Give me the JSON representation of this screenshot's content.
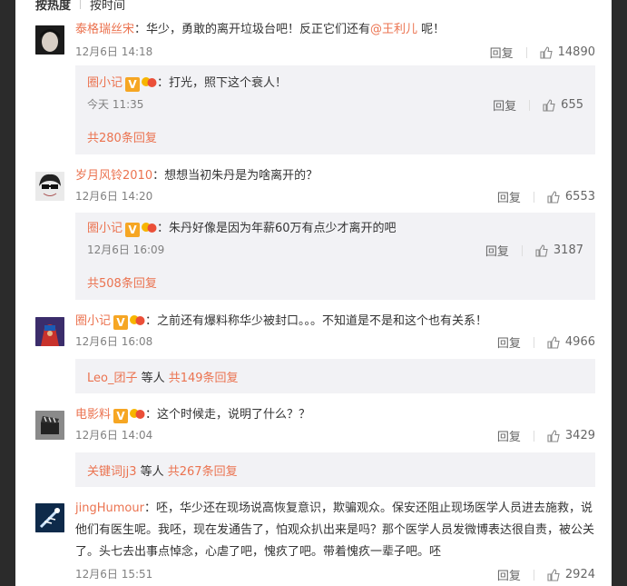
{
  "tabs": {
    "hot": "按热度",
    "time": "按时间"
  },
  "comments": [
    {
      "user": "泰格瑞丝宋",
      "text_before": "：华少，勇敢的离开垃圾台吧！反正它们还有",
      "mention": "@王利儿",
      "text_after": " 呢！",
      "time": "12月6日 14:18",
      "reply": "回复",
      "likes": "14890",
      "sub": {
        "user": "圈小记",
        "text": "：打光，照下这个衰人！",
        "time": "今天 11:35",
        "reply": "回复",
        "likes": "655",
        "more": "共280条回复"
      }
    },
    {
      "user": "岁月风铃2010",
      "text": "：想想当初朱丹是为啥离开的？",
      "time": "12月6日 14:20",
      "reply": "回复",
      "likes": "6553",
      "sub": {
        "user": "圈小记",
        "text": "：朱丹好像是因为年薪60万有点少才离开的吧",
        "time": "12月6日 16:09",
        "reply": "回复",
        "likes": "3187",
        "more": "共508条回复"
      }
    },
    {
      "user": "圈小记",
      "text": "：之前还有爆料称华少被封口。。。不知道是不是和这个也有关系！",
      "time": "12月6日 16:08",
      "reply": "回复",
      "likes": "4966",
      "more_user": "Leo_团子",
      "more_mid": " 等人 ",
      "more": "共149条回复"
    },
    {
      "user": "电影料",
      "text": "：这个时候走，说明了什么？？",
      "time": "12月6日 14:04",
      "reply": "回复",
      "likes": "3429",
      "more_user": "关键词jj3",
      "more_mid": " 等人 ",
      "more": "共267条回复"
    },
    {
      "user": "jingHumour",
      "text": "：呸，华少还在现场说高恢复意识，欺骗观众。保安还阻止现场医学人员进去施救，说他们有医生呢。我呸，现在发通告了，怕观众扒出来是吗？那个医学人员发微博表达很自责，被公关了。头七去出事点悼念，心虐了吧，愧疚了吧。带着愧疚一辈子吧。呸",
      "time": "12月6日 15:51",
      "reply": "回复",
      "likes": "2924"
    }
  ],
  "colors": {
    "accent": "#eb7350",
    "badge": "#f6a623",
    "subbox": "#f2f2f5"
  }
}
